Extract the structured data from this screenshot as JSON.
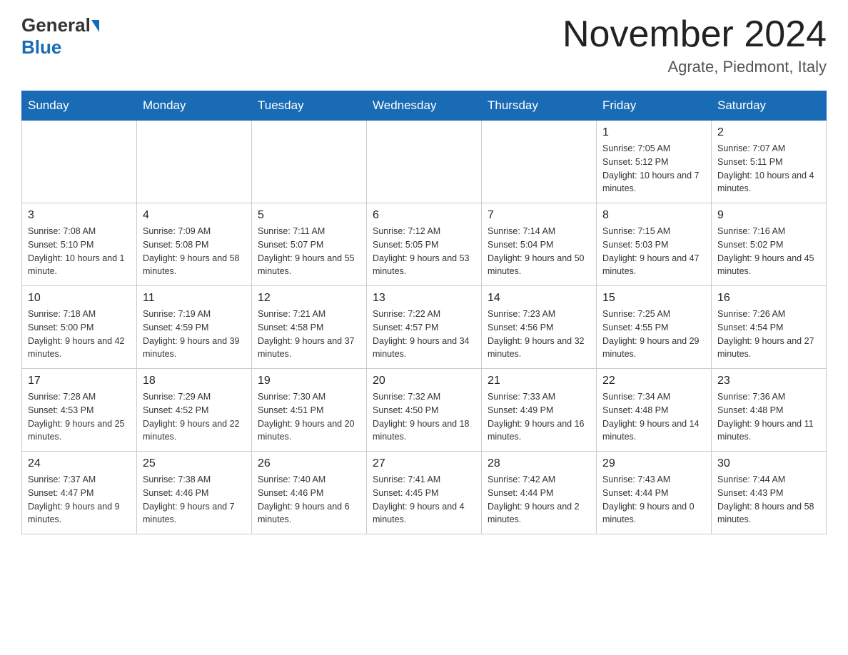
{
  "header": {
    "logo_general": "General",
    "logo_blue": "Blue",
    "month_title": "November 2024",
    "subtitle": "Agrate, Piedmont, Italy"
  },
  "weekdays": [
    "Sunday",
    "Monday",
    "Tuesday",
    "Wednesday",
    "Thursday",
    "Friday",
    "Saturday"
  ],
  "weeks": [
    [
      {
        "day": "",
        "info": ""
      },
      {
        "day": "",
        "info": ""
      },
      {
        "day": "",
        "info": ""
      },
      {
        "day": "",
        "info": ""
      },
      {
        "day": "",
        "info": ""
      },
      {
        "day": "1",
        "info": "Sunrise: 7:05 AM\nSunset: 5:12 PM\nDaylight: 10 hours and 7 minutes."
      },
      {
        "day": "2",
        "info": "Sunrise: 7:07 AM\nSunset: 5:11 PM\nDaylight: 10 hours and 4 minutes."
      }
    ],
    [
      {
        "day": "3",
        "info": "Sunrise: 7:08 AM\nSunset: 5:10 PM\nDaylight: 10 hours and 1 minute."
      },
      {
        "day": "4",
        "info": "Sunrise: 7:09 AM\nSunset: 5:08 PM\nDaylight: 9 hours and 58 minutes."
      },
      {
        "day": "5",
        "info": "Sunrise: 7:11 AM\nSunset: 5:07 PM\nDaylight: 9 hours and 55 minutes."
      },
      {
        "day": "6",
        "info": "Sunrise: 7:12 AM\nSunset: 5:05 PM\nDaylight: 9 hours and 53 minutes."
      },
      {
        "day": "7",
        "info": "Sunrise: 7:14 AM\nSunset: 5:04 PM\nDaylight: 9 hours and 50 minutes."
      },
      {
        "day": "8",
        "info": "Sunrise: 7:15 AM\nSunset: 5:03 PM\nDaylight: 9 hours and 47 minutes."
      },
      {
        "day": "9",
        "info": "Sunrise: 7:16 AM\nSunset: 5:02 PM\nDaylight: 9 hours and 45 minutes."
      }
    ],
    [
      {
        "day": "10",
        "info": "Sunrise: 7:18 AM\nSunset: 5:00 PM\nDaylight: 9 hours and 42 minutes."
      },
      {
        "day": "11",
        "info": "Sunrise: 7:19 AM\nSunset: 4:59 PM\nDaylight: 9 hours and 39 minutes."
      },
      {
        "day": "12",
        "info": "Sunrise: 7:21 AM\nSunset: 4:58 PM\nDaylight: 9 hours and 37 minutes."
      },
      {
        "day": "13",
        "info": "Sunrise: 7:22 AM\nSunset: 4:57 PM\nDaylight: 9 hours and 34 minutes."
      },
      {
        "day": "14",
        "info": "Sunrise: 7:23 AM\nSunset: 4:56 PM\nDaylight: 9 hours and 32 minutes."
      },
      {
        "day": "15",
        "info": "Sunrise: 7:25 AM\nSunset: 4:55 PM\nDaylight: 9 hours and 29 minutes."
      },
      {
        "day": "16",
        "info": "Sunrise: 7:26 AM\nSunset: 4:54 PM\nDaylight: 9 hours and 27 minutes."
      }
    ],
    [
      {
        "day": "17",
        "info": "Sunrise: 7:28 AM\nSunset: 4:53 PM\nDaylight: 9 hours and 25 minutes."
      },
      {
        "day": "18",
        "info": "Sunrise: 7:29 AM\nSunset: 4:52 PM\nDaylight: 9 hours and 22 minutes."
      },
      {
        "day": "19",
        "info": "Sunrise: 7:30 AM\nSunset: 4:51 PM\nDaylight: 9 hours and 20 minutes."
      },
      {
        "day": "20",
        "info": "Sunrise: 7:32 AM\nSunset: 4:50 PM\nDaylight: 9 hours and 18 minutes."
      },
      {
        "day": "21",
        "info": "Sunrise: 7:33 AM\nSunset: 4:49 PM\nDaylight: 9 hours and 16 minutes."
      },
      {
        "day": "22",
        "info": "Sunrise: 7:34 AM\nSunset: 4:48 PM\nDaylight: 9 hours and 14 minutes."
      },
      {
        "day": "23",
        "info": "Sunrise: 7:36 AM\nSunset: 4:48 PM\nDaylight: 9 hours and 11 minutes."
      }
    ],
    [
      {
        "day": "24",
        "info": "Sunrise: 7:37 AM\nSunset: 4:47 PM\nDaylight: 9 hours and 9 minutes."
      },
      {
        "day": "25",
        "info": "Sunrise: 7:38 AM\nSunset: 4:46 PM\nDaylight: 9 hours and 7 minutes."
      },
      {
        "day": "26",
        "info": "Sunrise: 7:40 AM\nSunset: 4:46 PM\nDaylight: 9 hours and 6 minutes."
      },
      {
        "day": "27",
        "info": "Sunrise: 7:41 AM\nSunset: 4:45 PM\nDaylight: 9 hours and 4 minutes."
      },
      {
        "day": "28",
        "info": "Sunrise: 7:42 AM\nSunset: 4:44 PM\nDaylight: 9 hours and 2 minutes."
      },
      {
        "day": "29",
        "info": "Sunrise: 7:43 AM\nSunset: 4:44 PM\nDaylight: 9 hours and 0 minutes."
      },
      {
        "day": "30",
        "info": "Sunrise: 7:44 AM\nSunset: 4:43 PM\nDaylight: 8 hours and 58 minutes."
      }
    ]
  ]
}
